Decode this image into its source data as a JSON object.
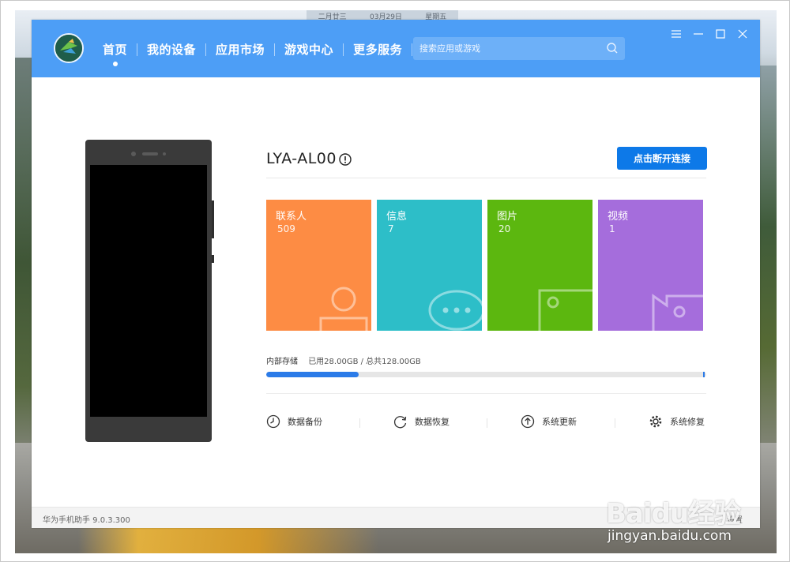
{
  "datebar": {
    "lunar": "二月廿三",
    "date": "03月29日",
    "weekday": "星期五"
  },
  "header": {
    "nav": [
      {
        "label": "首页",
        "active": true
      },
      {
        "label": "我的设备",
        "active": false
      },
      {
        "label": "应用市场",
        "active": false
      },
      {
        "label": "游戏中心",
        "active": false
      },
      {
        "label": "更多服务",
        "active": false
      }
    ],
    "search_placeholder": "搜索应用或游戏"
  },
  "device": {
    "name": "LYA-AL00",
    "disconnect_label": "点击断开连接"
  },
  "tiles": [
    {
      "label": "联系人",
      "count": "509",
      "color": "#fd8c44",
      "icon": "contact-icon"
    },
    {
      "label": "信息",
      "count": "7",
      "color": "#2dbec8",
      "icon": "message-icon"
    },
    {
      "label": "图片",
      "count": "20",
      "color": "#5cb70f",
      "icon": "image-icon"
    },
    {
      "label": "视频",
      "count": "1",
      "color": "#a56ddc",
      "icon": "video-icon"
    }
  ],
  "storage": {
    "label": "内部存储",
    "usage": "已用28.00GB / 总共128.00GB",
    "used_fraction": 0.21
  },
  "actions": [
    {
      "label": "数据备份",
      "icon": "backup-clock-icon"
    },
    {
      "label": "数据恢复",
      "icon": "restore-icon"
    },
    {
      "label": "系统更新",
      "icon": "update-arrow-icon"
    },
    {
      "label": "系统修复",
      "icon": "repair-gear-icon"
    }
  ],
  "footer": {
    "version": "华为手机助手 9.0.3.300",
    "link": "设置"
  },
  "watermark": {
    "brand": "Baidu经验",
    "url": "jingyan.baidu.com"
  },
  "colors": {
    "header": "#4d9ef6",
    "primary_button": "#0d79e8",
    "progress": "#2b7be8"
  }
}
